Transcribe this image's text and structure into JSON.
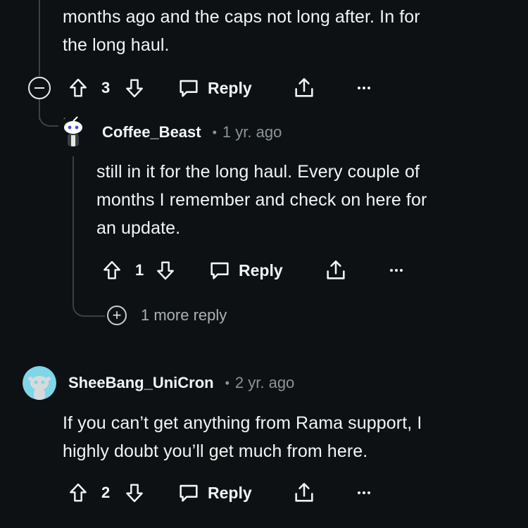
{
  "comments": [
    {
      "body_lines": [
        "months ago and the caps not long after. In for",
        "the long haul."
      ],
      "votes": "3",
      "reply_label": "Reply"
    },
    {
      "username": "Coffee_Beast",
      "dot": "•",
      "age": "1 yr. ago",
      "body_lines": [
        "still in it for the long haul. Every couple of",
        "months I remember and check on here for",
        "an update."
      ],
      "votes": "1",
      "reply_label": "Reply",
      "more_replies": "1 more reply"
    },
    {
      "username": "SheeBang_UniCron",
      "dot": "•",
      "age": "2 yr. ago",
      "body_lines": [
        "If you can’t get anything from Rama support, I",
        "highly doubt you’ll get much from here."
      ],
      "votes": "2",
      "reply_label": "Reply"
    }
  ],
  "icons": {
    "collapse": "collapse-minus-icon",
    "upvote": "arrow-up-icon",
    "downvote": "arrow-down-icon",
    "reply": "speech-bubble-icon",
    "share": "share-icon",
    "more": "ellipsis-icon",
    "expand": "plus-circle-icon"
  },
  "colors": {
    "background": "#0e1113",
    "text": "#f2f4f5",
    "muted": "#8a9499",
    "thread_line": "#3a4044",
    "avatar_cyan": "#7ed6e8"
  }
}
